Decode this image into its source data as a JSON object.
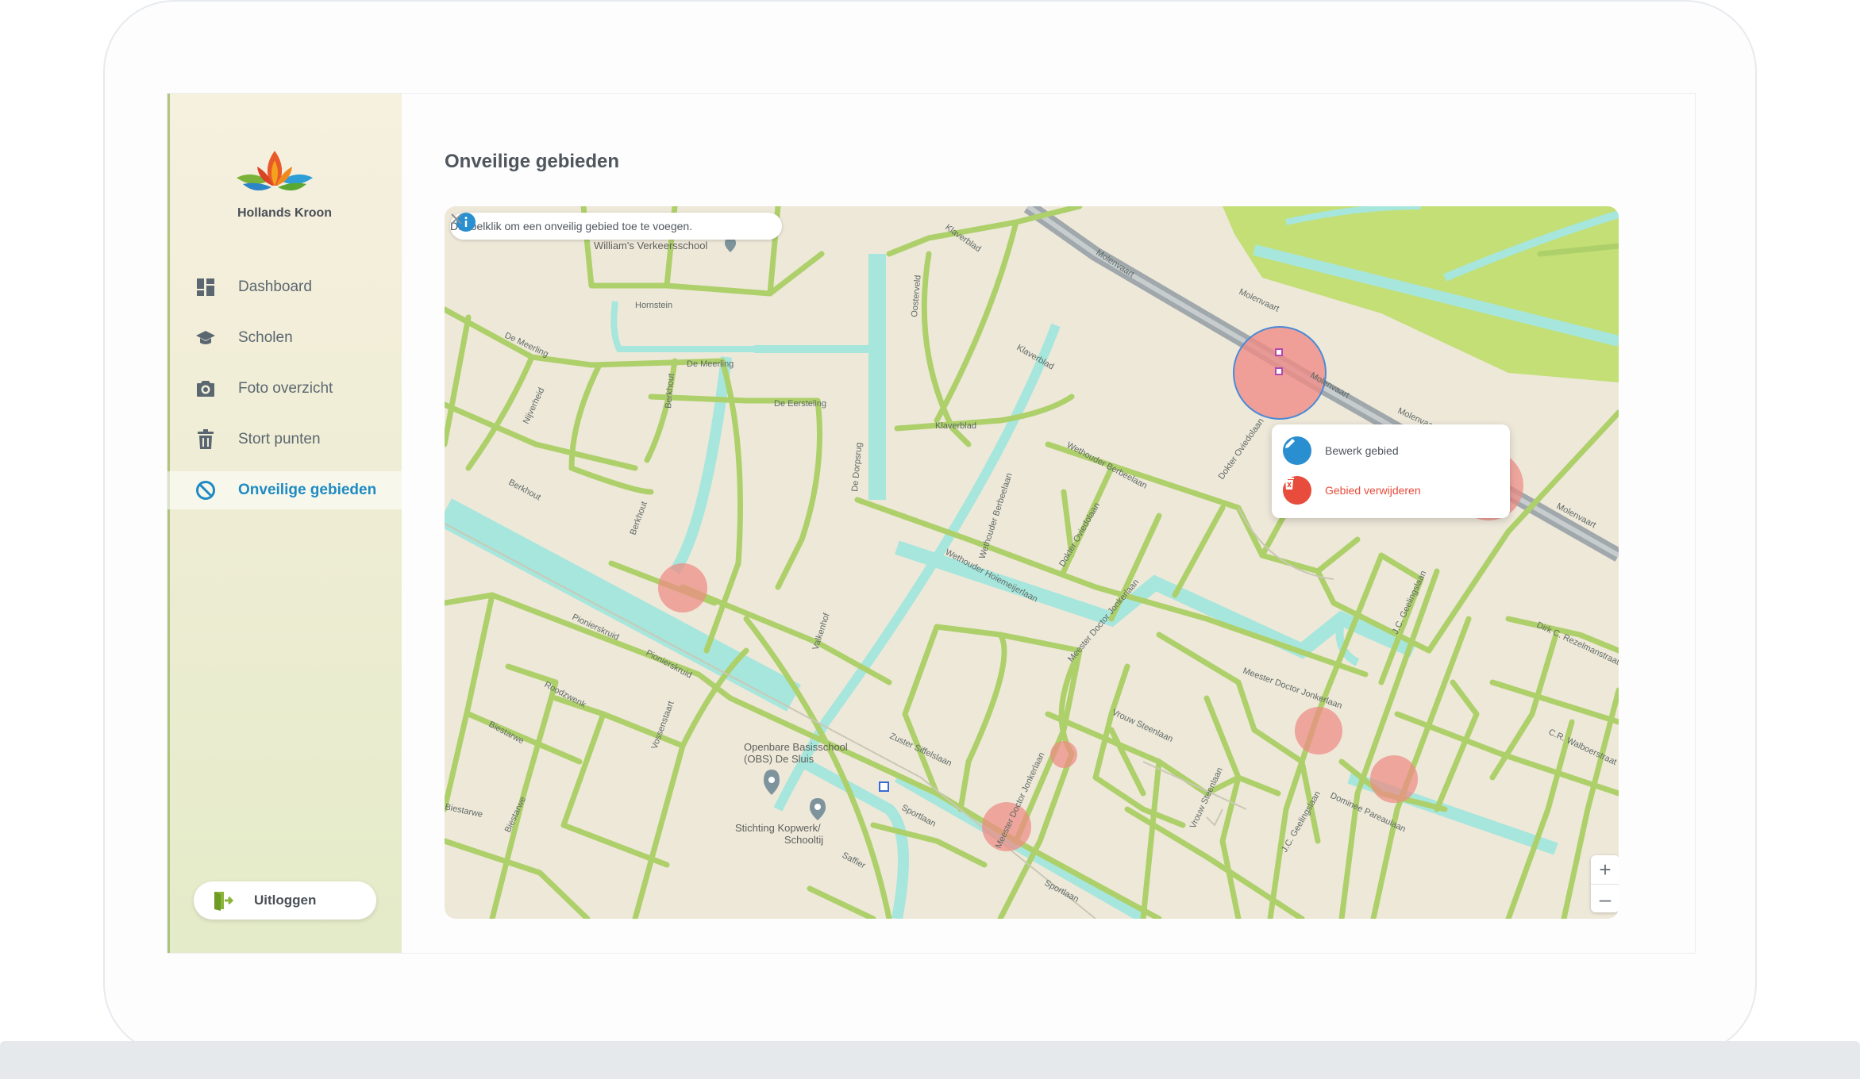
{
  "app": {
    "brand": "Hollands Kroon"
  },
  "sidebar": {
    "items": [
      {
        "label": "Dashboard",
        "icon": "dashboard-icon",
        "active": false
      },
      {
        "label": "Scholen",
        "icon": "graduation-cap-icon",
        "active": false
      },
      {
        "label": "Foto overzicht",
        "icon": "camera-icon",
        "active": false
      },
      {
        "label": "Stort punten",
        "icon": "trash-icon",
        "active": false
      },
      {
        "label": "Onveilige gebieden",
        "icon": "forbidden-icon",
        "active": true
      }
    ],
    "logout_label": "Uitloggen"
  },
  "main": {
    "title": "Onveilige gebieden"
  },
  "map": {
    "info_text": "Dubbelklik om een onveilig gebied toe te voegen.",
    "context_menu": {
      "edit_label": "Bewerk gebied",
      "delete_label": "Gebied verwijderen"
    },
    "zoom_in": "+",
    "zoom_out": "–",
    "labels": {
      "molenvaart": "Molenvaart",
      "klaverblad": "Klaverblad",
      "hornstein": "Hornstein",
      "de_meerling": "De Meerling",
      "de_eersteling": "De Eersteling",
      "berkhout": "Berkhout",
      "nijverheid": "Nijverheid",
      "de_dorpsrug": "De Dorpsrug",
      "oosterveld": "Oosterveld",
      "valkenhof": "Valkenhof",
      "pionierskruid": "Pionierskruid",
      "roodzwenk": "Roodzwenk",
      "biestarwe": "Biestarwe",
      "vossenstaart": "Vossenstaart",
      "wethouder_berbeelaan": "Wethouder Berbeelaan",
      "wethouder_hoiemeijerlaan": "Wethouder Hoiemeijerlaan",
      "dokter_oviedolaan": "Dokter Oviedolaan",
      "meester_doctor_jonkerlaan": "Meester Doctor Jonkerlaan",
      "vrouw_steenlaan": "Vrouw Steenlaan",
      "dominee_pareaulaan": "Dominee Pareaulaan",
      "jc_gaellaan": "J.C. Geelingslaan",
      "zuster_siffelslaan": "Zuster Siffelslaan",
      "sportlaan": "Sportlaan",
      "saffier": "Saffier",
      "dirk_c_rezelmanstraat": "Dirk C. Rezelmanstraat",
      "c_r_walboerstraat": "C.R. Walboerstraat",
      "school_obs": "Openbare Basisschool (OBS) De Sluis",
      "school_obs_line1": "Openbare Basisschool",
      "school_obs_line2": "(OBS) De Sluis",
      "kopwerk_line1": "Stichting Kopwerk/",
      "kopwerk_line2": "Schooltij",
      "verkeersschool": "William's Verkeersschool"
    }
  },
  "colors": {
    "accent": "#1e8bc3",
    "danger": "#e74c3c",
    "zone_fill": "#ef8a84",
    "road": "#aed06a",
    "water": "#a6e6dc",
    "land": "#eee8d9"
  }
}
